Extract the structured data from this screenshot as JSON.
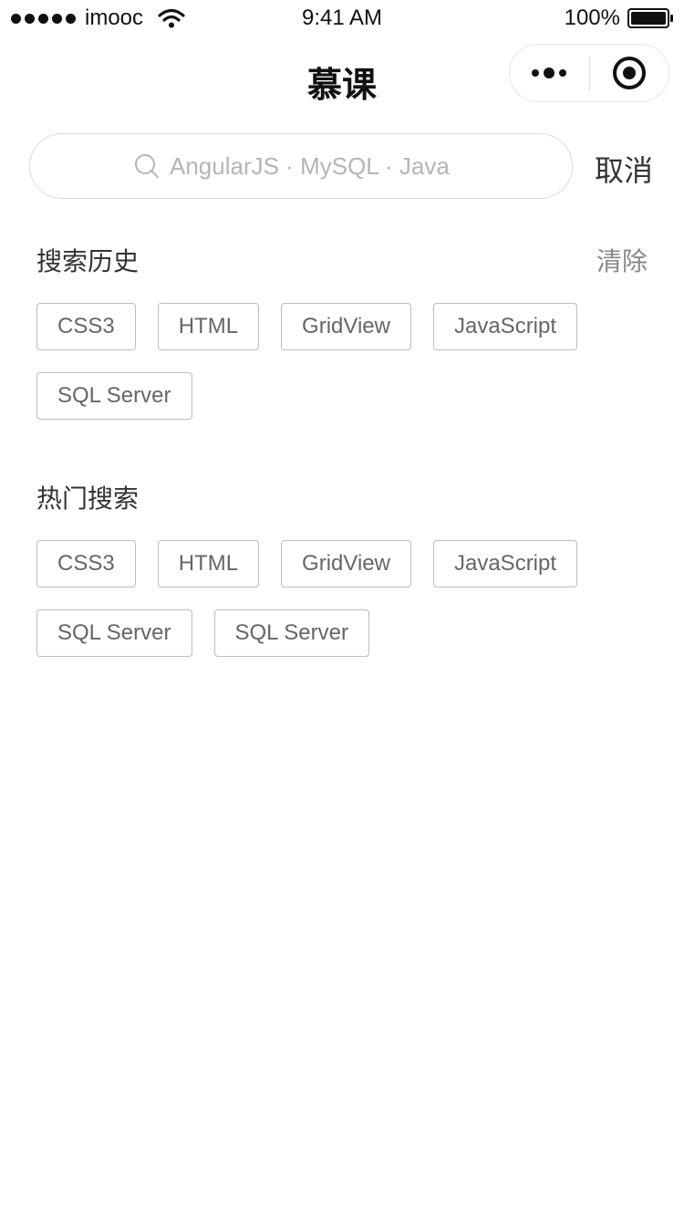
{
  "status_bar": {
    "carrier": "imooc",
    "time": "9:41 AM",
    "battery": "100%"
  },
  "nav": {
    "title": "慕课",
    "more_icon": "more-dots-icon",
    "close_icon": "target-circle-icon"
  },
  "search": {
    "placeholder": "AngularJS · MySQL · Java",
    "value": "",
    "icon": "search-icon",
    "cancel_label": "取消"
  },
  "history": {
    "title": "搜索历史",
    "clear_label": "清除",
    "tags": [
      "CSS3",
      "HTML",
      "GridView",
      "JavaScript",
      "SQL Server"
    ]
  },
  "hot": {
    "title": "热门搜索",
    "tags": [
      "CSS3",
      "HTML",
      "GridView",
      "JavaScript",
      "SQL Server",
      "SQL Server"
    ]
  }
}
